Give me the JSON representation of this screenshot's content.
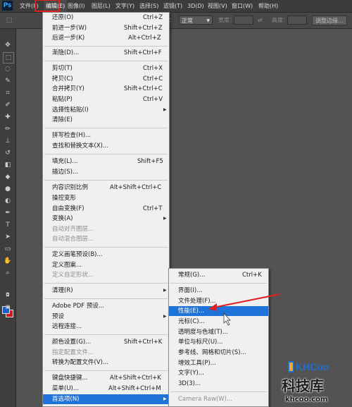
{
  "app": {
    "logo": "Ps"
  },
  "menubar": {
    "items": [
      {
        "label": "文件(F)"
      },
      {
        "label": "编辑(E)"
      },
      {
        "label": "图像(I)"
      },
      {
        "label": "图层(L)"
      },
      {
        "label": "文字(Y)"
      },
      {
        "label": "选择(S)"
      },
      {
        "label": "滤镜(T)"
      },
      {
        "label": "3D(D)"
      },
      {
        "label": "视图(V)"
      },
      {
        "label": "窗口(W)"
      },
      {
        "label": "帮助(H)"
      }
    ]
  },
  "options_bar": {
    "style_label": "样式：",
    "style_value": "正常",
    "width_label": "宽度：",
    "height_label": "高度：",
    "refine_edge": "调整边缘..."
  },
  "edit_menu": {
    "items": [
      {
        "label": "还原(O)",
        "shortcut": "Ctrl+Z"
      },
      {
        "label": "前进一步(W)",
        "shortcut": "Shift+Ctrl+Z"
      },
      {
        "label": "后退一步(K)",
        "shortcut": "Alt+Ctrl+Z"
      },
      {
        "label": "渐隐(D)...",
        "shortcut": "Shift+Ctrl+F"
      },
      {
        "label": "剪切(T)",
        "shortcut": "Ctrl+X"
      },
      {
        "label": "拷贝(C)",
        "shortcut": "Ctrl+C"
      },
      {
        "label": "合并拷贝(Y)",
        "shortcut": "Shift+Ctrl+C"
      },
      {
        "label": "粘贴(P)",
        "shortcut": "Ctrl+V"
      },
      {
        "label": "选择性粘贴(I)",
        "shortcut": ""
      },
      {
        "label": "清除(E)",
        "shortcut": ""
      },
      {
        "label": "拼写检查(H)...",
        "shortcut": ""
      },
      {
        "label": "查找和替换文本(X)...",
        "shortcut": ""
      },
      {
        "label": "填充(L)...",
        "shortcut": "Shift+F5"
      },
      {
        "label": "描边(S)...",
        "shortcut": ""
      },
      {
        "label": "内容识别比例",
        "shortcut": "Alt+Shift+Ctrl+C"
      },
      {
        "label": "操控变形",
        "shortcut": ""
      },
      {
        "label": "自由变换(F)",
        "shortcut": "Ctrl+T"
      },
      {
        "label": "变换(A)",
        "shortcut": ""
      },
      {
        "label": "自动对齐图层...",
        "shortcut": ""
      },
      {
        "label": "自动混合图层...",
        "shortcut": ""
      },
      {
        "label": "定义画笔预设(B)...",
        "shortcut": ""
      },
      {
        "label": "定义图案...",
        "shortcut": ""
      },
      {
        "label": "定义自定形状...",
        "shortcut": ""
      },
      {
        "label": "清理(R)",
        "shortcut": ""
      },
      {
        "label": "Adobe PDF 预设...",
        "shortcut": ""
      },
      {
        "label": "预设",
        "shortcut": ""
      },
      {
        "label": "远程连接...",
        "shortcut": ""
      },
      {
        "label": "颜色设置(G)...",
        "shortcut": "Shift+Ctrl+K"
      },
      {
        "label": "指定配置文件...",
        "shortcut": ""
      },
      {
        "label": "转换为配置文件(V)...",
        "shortcut": ""
      },
      {
        "label": "键盘快捷键...",
        "shortcut": "Alt+Shift+Ctrl+K"
      },
      {
        "label": "菜单(U)...",
        "shortcut": "Alt+Shift+Ctrl+M"
      },
      {
        "label": "首选项(N)",
        "shortcut": ""
      }
    ]
  },
  "prefs_submenu": {
    "items": [
      {
        "label": "常规(G)...",
        "shortcut": "Ctrl+K"
      },
      {
        "label": "界面(I)..."
      },
      {
        "label": "文件处理(F)..."
      },
      {
        "label": "性能(E)..."
      },
      {
        "label": "光标(C)..."
      },
      {
        "label": "透明度与色域(T)..."
      },
      {
        "label": "单位与标尺(U)..."
      },
      {
        "label": "参考线、网格和切片(S)..."
      },
      {
        "label": "增效工具(P)..."
      },
      {
        "label": "文字(Y)..."
      },
      {
        "label": "3D(3)..."
      },
      {
        "label": "Camera Raw(W)..."
      }
    ]
  },
  "watermark": {
    "logo_text": "KHCoo",
    "title": "科技库",
    "url": "khcoo.com"
  },
  "colors": {
    "highlight": "#1e73d8",
    "annotation": "#e02020",
    "foreground_swatch": "#1f5fc4",
    "background_swatch": "#d01818"
  }
}
